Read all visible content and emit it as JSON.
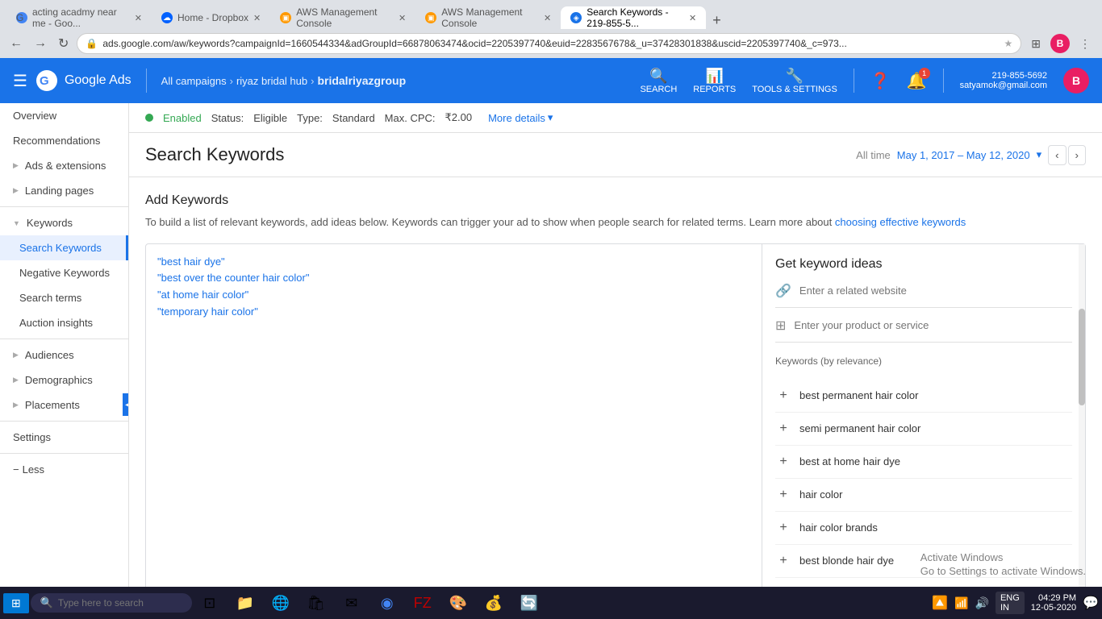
{
  "browser": {
    "tabs": [
      {
        "id": "tab1",
        "icon_color": "#4285f4",
        "label": "acting acadmy near me - Goo...",
        "active": false,
        "icon": "G"
      },
      {
        "id": "tab2",
        "icon_color": "#0061ff",
        "label": "Home - Dropbox",
        "active": false,
        "icon": "☁"
      },
      {
        "id": "tab3",
        "icon_color": "#ff9900",
        "label": "AWS Management Console",
        "active": false,
        "icon": "▣"
      },
      {
        "id": "tab4",
        "icon_color": "#ff9900",
        "label": "AWS Management Console",
        "active": false,
        "icon": "▣"
      },
      {
        "id": "tab5",
        "icon_color": "#1a73e8",
        "label": "Search Keywords - 219-855-5...",
        "active": true,
        "icon": "◈"
      }
    ],
    "url": "ads.google.com/aw/keywords?campaignId=1660544334&adGroupId=66878063474&ocid=2205397740&euid=2283567678&_u=37428301838&uscid=2205397740&_c=973...",
    "back_enabled": false,
    "forward_enabled": false
  },
  "ads_header": {
    "all_campaigns": "All campaigns",
    "campaign_name": "riyaz bridal hub",
    "account_name": "bridalriyazgroup",
    "search_label": "SEARCH",
    "reports_label": "REPORTS",
    "tools_settings_label": "TOOLS & SETTINGS",
    "phone": "219-855-5692",
    "email": "satyamok@gmail.com",
    "user_initial": "B",
    "notif_count": "1"
  },
  "status_bar": {
    "status": "Enabled",
    "status_label": "Status:",
    "status_value": "Eligible",
    "type_label": "Type:",
    "type_value": "Standard",
    "max_cpc_label": "Max. CPC:",
    "max_cpc_value": "₹2.00",
    "more_details": "More details"
  },
  "page_header": {
    "title": "Search Keywords",
    "date_range_label": "All time",
    "date_range": "May 1, 2017 – May 12, 2020"
  },
  "add_keywords": {
    "title": "Add Keywords",
    "description": "To build a list of relevant keywords, add ideas below. Keywords can trigger your ad to show when people search for related terms. Learn more about",
    "learn_more_text": "choosing effective keywords",
    "input_keywords": [
      "\"best hair dye\"",
      "\"best over the counter hair color\"",
      "\"at home hair color\"",
      "\"temporary hair color\""
    ]
  },
  "keyword_ideas": {
    "title": "Get keyword ideas",
    "website_placeholder": "Enter a related website",
    "product_placeholder": "Enter your product or service",
    "relevance_label": "Keywords (by relevance)",
    "suggestions": [
      "best permanent hair color",
      "semi permanent hair color",
      "best at home hair dye",
      "hair color",
      "hair color brands",
      "best blonde hair dye"
    ]
  },
  "sidebar": {
    "overview": "Overview",
    "recommendations": "Recommendations",
    "ads_extensions": "Ads & extensions",
    "landing_pages": "Landing pages",
    "keywords": "Keywords",
    "search_keywords": "Search Keywords",
    "negative_keywords": "Negative Keywords",
    "search_terms": "Search terms",
    "auction_insights": "Auction insights",
    "audiences": "Audiences",
    "demographics": "Demographics",
    "placements": "Placements",
    "settings": "Settings",
    "less": "Less"
  },
  "taskbar": {
    "search_placeholder": "Type here to search",
    "lang": "ENG",
    "region": "IN",
    "time": "04:29 PM",
    "date": "12-05-2020"
  },
  "watermark": {
    "line1": "Activate Windows",
    "line2": "Go to Settings to activate Windows."
  }
}
